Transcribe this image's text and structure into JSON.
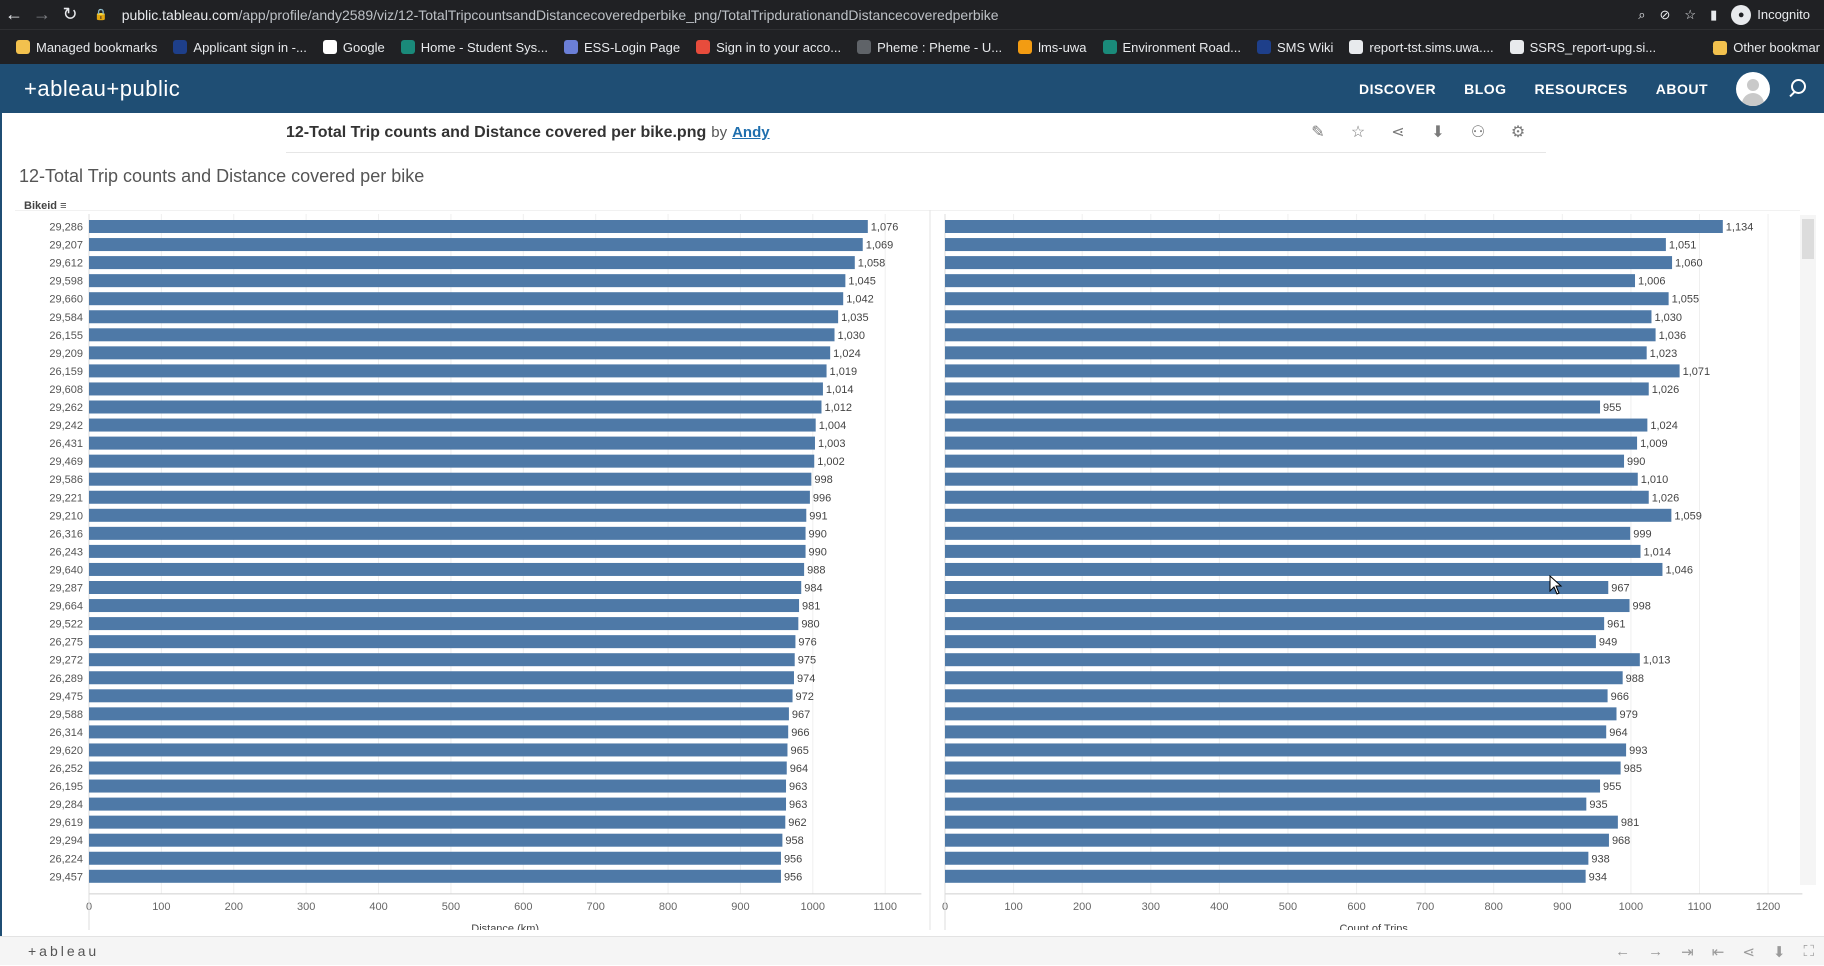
{
  "browser": {
    "back": "←",
    "forward": "→",
    "reload": "↻",
    "url_host": "public.tableau.com",
    "url_path": "/app/profile/andy2589/viz/12-TotalTripcountsandDistancecoveredperbike_png/TotalTripdurationandDistancecoveredperbike",
    "zoom_icon": "⌕",
    "eye_icon": "⊘",
    "star_icon": "☆",
    "sidebar_icon": "▮",
    "incognito_label": "Incognito"
  },
  "bookmarks": {
    "items": [
      {
        "label": "Managed bookmarks",
        "color": "#f2c14e"
      },
      {
        "label": "Applicant sign in -...",
        "color": "#1e3f8a"
      },
      {
        "label": "Google",
        "color": "#ffffff"
      },
      {
        "label": "Home - Student Sys...",
        "color": "#1a8a7a"
      },
      {
        "label": "ESS-Login Page",
        "color": "#6b7fd7"
      },
      {
        "label": "Sign in to your acco...",
        "color": "#e74c3c"
      },
      {
        "label": "Pheme : Pheme - U...",
        "color": "#5f6368"
      },
      {
        "label": "lms-uwa",
        "color": "#f39c12"
      },
      {
        "label": "Environment Road...",
        "color": "#1a8a7a"
      },
      {
        "label": "SMS Wiki",
        "color": "#1e3f8a"
      },
      {
        "label": "report-tst.sims.uwa....",
        "color": "#e8eaed"
      },
      {
        "label": "SSRS_report-upg.si...",
        "color": "#e8eaed"
      }
    ],
    "more": "»",
    "other": "Other bookmar"
  },
  "tableau": {
    "logo": "+ableau+public",
    "nav": [
      "DISCOVER",
      "BLOG",
      "RESOURCES",
      "ABOUT"
    ]
  },
  "viz": {
    "title": "12-Total Trip counts and Distance covered per bike.png",
    "by": "by",
    "author": "Andy",
    "tools": [
      "✎",
      "☆",
      "⋖",
      "⬇",
      "⚇",
      "⚙"
    ],
    "sheet_title": "12-Total Trip counts and Distance covered per bike",
    "row_header": "Bikeid"
  },
  "chart_data": {
    "type": "bar",
    "categories": [
      "29,286",
      "29,207",
      "29,612",
      "29,598",
      "29,660",
      "29,584",
      "26,155",
      "29,209",
      "26,159",
      "29,608",
      "29,262",
      "29,242",
      "26,431",
      "29,469",
      "29,586",
      "29,221",
      "29,210",
      "26,316",
      "26,243",
      "29,640",
      "29,287",
      "29,664",
      "29,522",
      "26,275",
      "29,272",
      "26,289",
      "29,475",
      "29,588",
      "26,314",
      "29,620",
      "26,252",
      "26,195",
      "29,284",
      "29,619",
      "29,294",
      "26,224",
      "29,457"
    ],
    "series": [
      {
        "values": [
          1076,
          1069,
          1058,
          1045,
          1042,
          1035,
          1030,
          1024,
          1019,
          1014,
          1012,
          1004,
          1003,
          1002,
          998,
          996,
          991,
          990,
          990,
          988,
          984,
          981,
          980,
          976,
          975,
          974,
          972,
          967,
          966,
          965,
          964,
          963,
          963,
          962,
          958,
          956,
          956
        ]
      },
      {
        "values": [
          1134,
          1051,
          1060,
          1006,
          1055,
          1030,
          1036,
          1023,
          1071,
          1026,
          955,
          1024,
          1009,
          990,
          1010,
          1026,
          1059,
          999,
          1014,
          1046,
          967,
          998,
          961,
          949,
          1013,
          988,
          966,
          979,
          964,
          993,
          985,
          955,
          935,
          981,
          968,
          938,
          934
        ]
      }
    ],
    "panels": [
      {
        "xlabel": "Distance (km)",
        "xlim": [
          0,
          1150
        ],
        "ticks": [
          0,
          100,
          200,
          300,
          400,
          500,
          600,
          700,
          800,
          900,
          1000,
          1100
        ]
      },
      {
        "xlabel": "Count of Trips",
        "xlim": [
          0,
          1250
        ],
        "ticks": [
          0,
          100,
          200,
          300,
          400,
          500,
          600,
          700,
          800,
          900,
          1000,
          1100,
          1200
        ]
      }
    ],
    "bar_color": "#4e79a7",
    "label_format": "thousands-comma"
  },
  "footer": {
    "logo": "+ableau",
    "tools": [
      "←",
      "→",
      "⇥",
      "⇤",
      "⋖",
      "⬇",
      "⛶"
    ]
  }
}
